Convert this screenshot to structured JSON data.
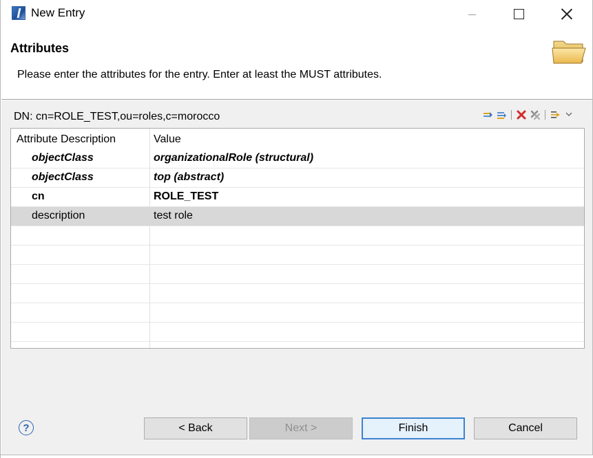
{
  "window": {
    "title": "New Entry"
  },
  "header": {
    "title": "Attributes",
    "description": "Please enter the attributes for the entry. Enter at least the MUST attributes."
  },
  "dn": {
    "label": "DN: cn=ROLE_TEST,ou=roles,c=morocco"
  },
  "toolbar": {
    "icons": [
      "new-value-icon",
      "new-attribute-icon",
      "delete-icon",
      "delete-all-icon",
      "menu-icon"
    ]
  },
  "table": {
    "columns": [
      "Attribute Description",
      "Value"
    ],
    "rows": [
      {
        "attribute": "objectClass",
        "value": "organizationalRole (structural)",
        "style": "bold-italic"
      },
      {
        "attribute": "objectClass",
        "value": "top (abstract)",
        "style": "bold-italic"
      },
      {
        "attribute": "cn",
        "value": "ROLE_TEST",
        "style": "bold"
      },
      {
        "attribute": "description",
        "value": "test role",
        "style": "normal",
        "selected": true
      }
    ]
  },
  "footer": {
    "help_icon": "?",
    "back_label": "< Back",
    "next_label": "Next >",
    "finish_label": "Finish",
    "cancel_label": "Cancel"
  },
  "colors": {
    "selected_row": "#d8d8d8",
    "default_button_border": "#3b82d0",
    "panel_bg": "#f0f0f0"
  }
}
